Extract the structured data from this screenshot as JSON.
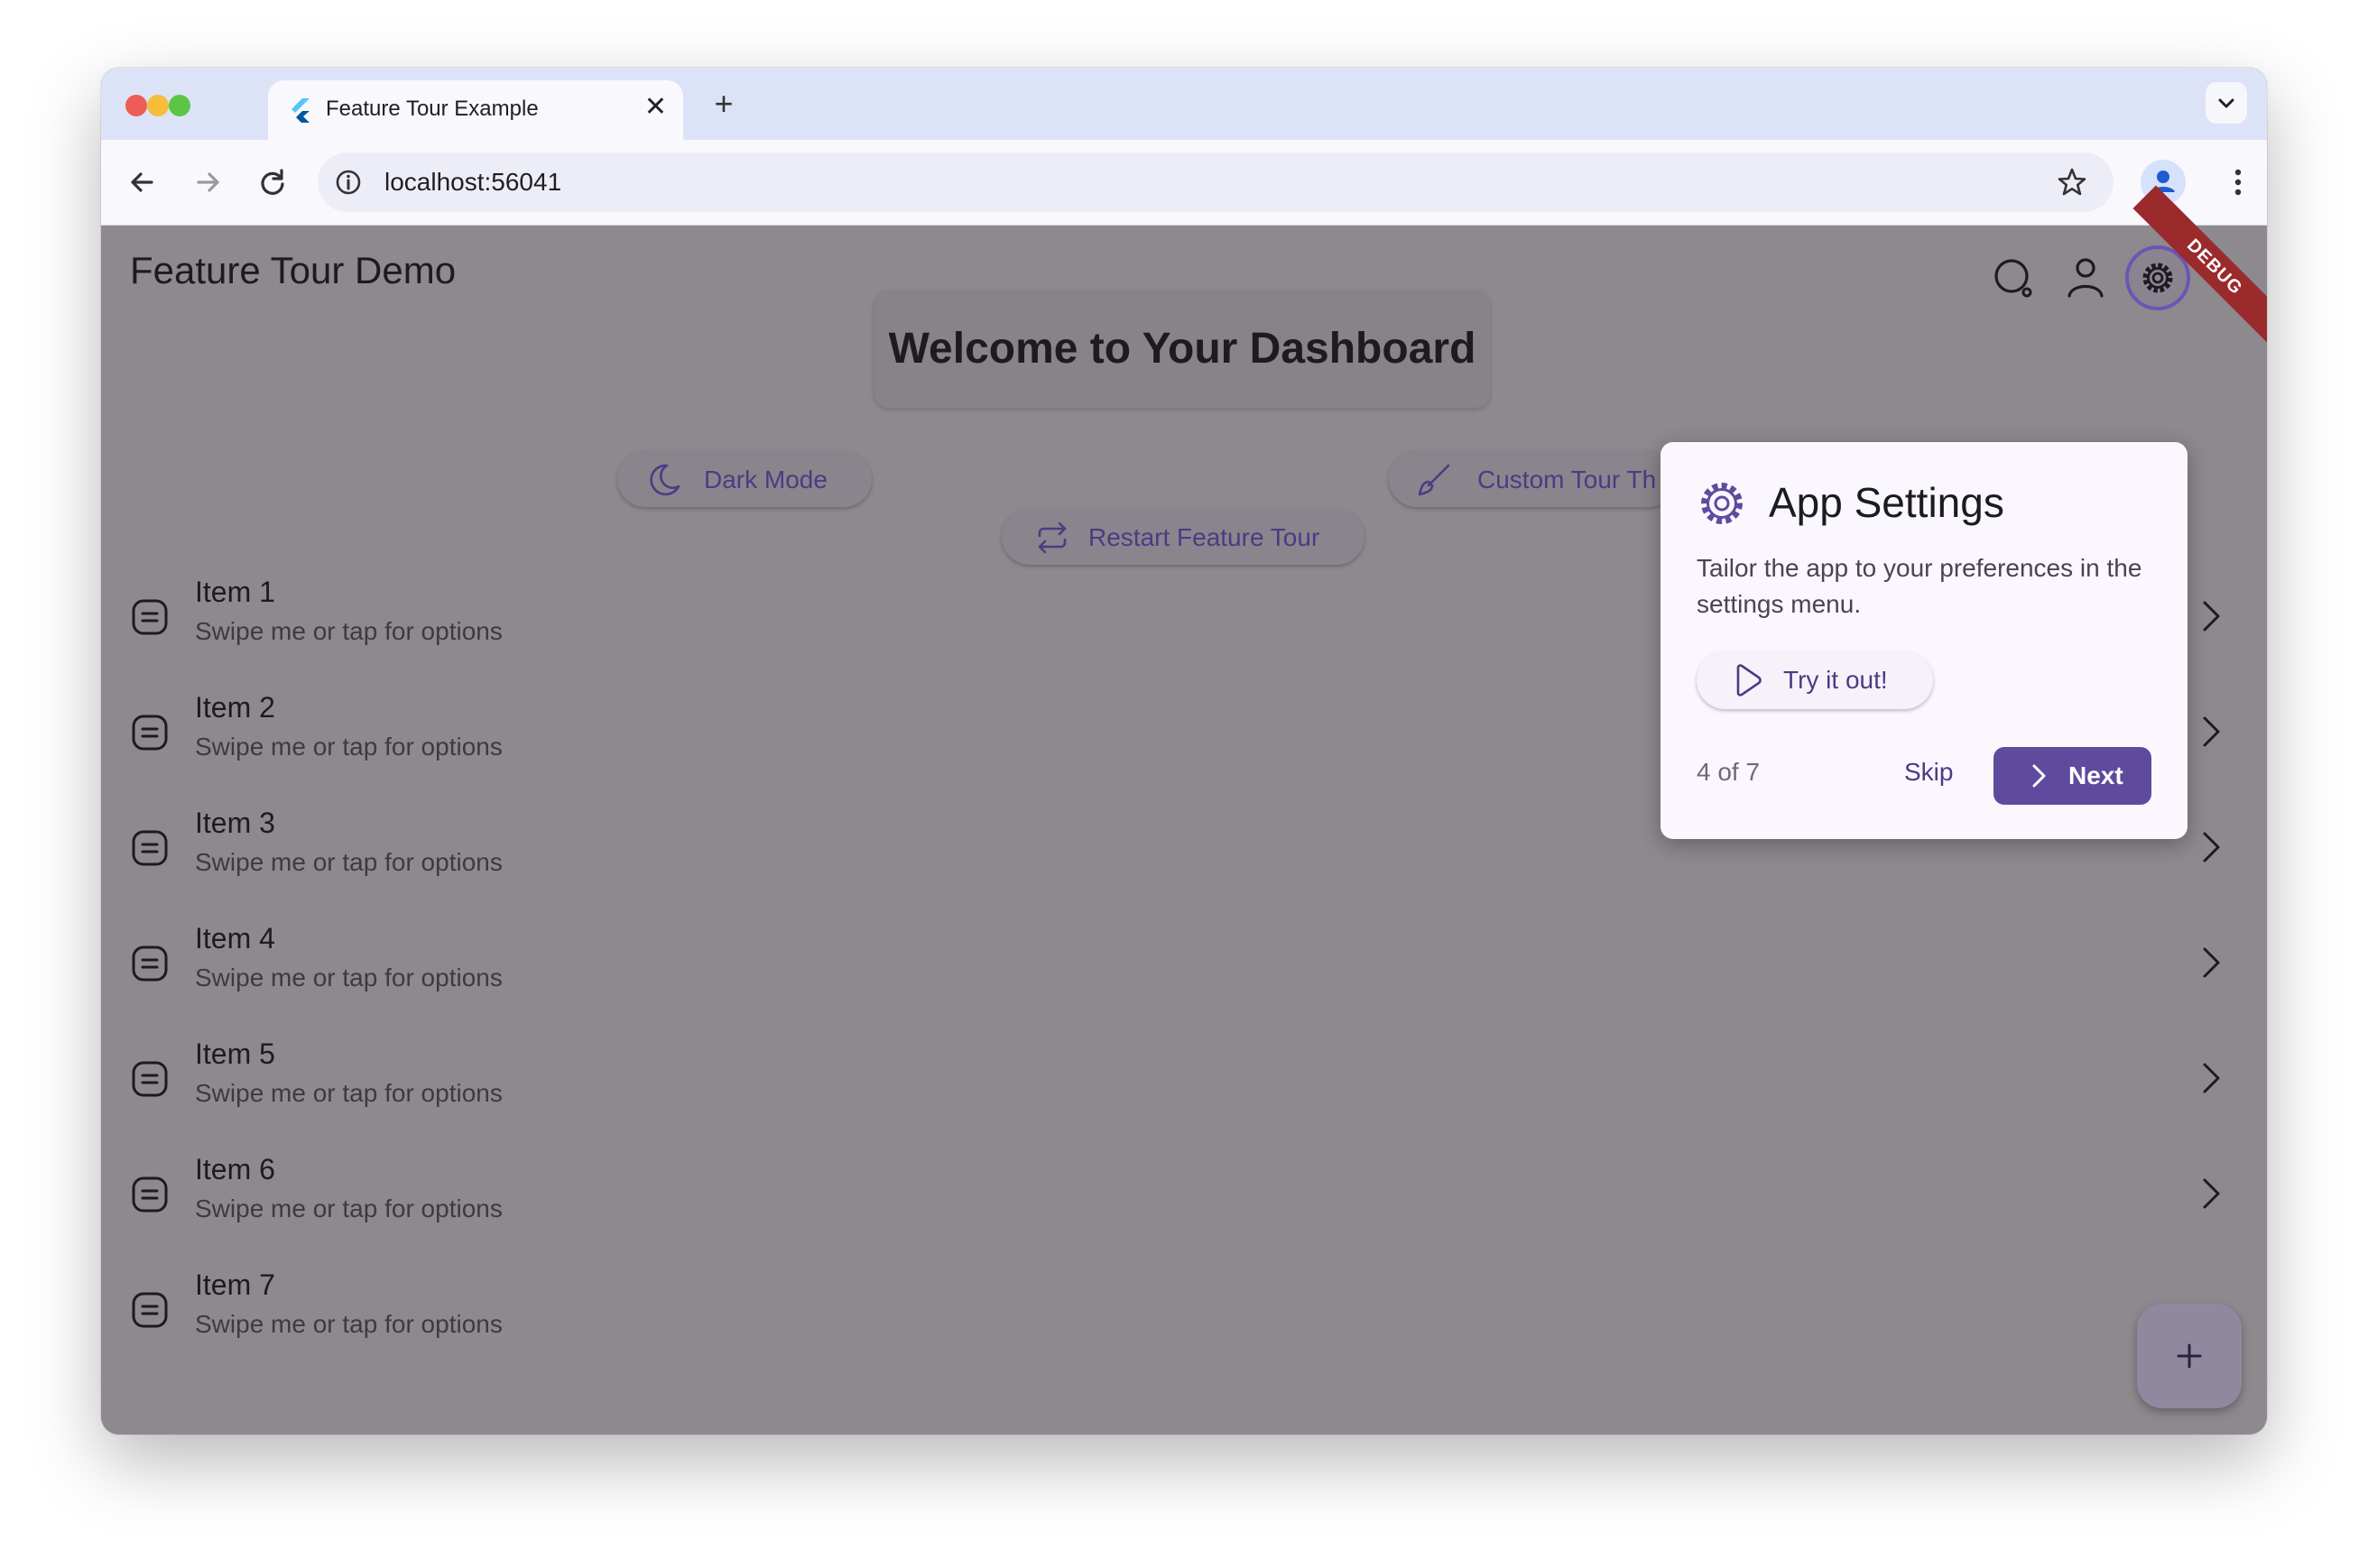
{
  "browser": {
    "tab_title": "Feature Tour Example",
    "tab_close": "✕",
    "new_tab": "+",
    "url": "localhost:56041"
  },
  "app": {
    "title": "Feature Tour Demo",
    "debug_banner": "DEBUG",
    "welcome": "Welcome to Your Dashboard",
    "buttons": {
      "dark_mode": "Dark Mode",
      "custom_theme": "Custom Tour Th",
      "restart_tour": "Restart Feature Tour"
    },
    "items": [
      {
        "title": "Item 1",
        "subtitle": "Swipe me or tap for options"
      },
      {
        "title": "Item 2",
        "subtitle": "Swipe me or tap for options"
      },
      {
        "title": "Item 3",
        "subtitle": "Swipe me or tap for options"
      },
      {
        "title": "Item 4",
        "subtitle": "Swipe me or tap for options"
      },
      {
        "title": "Item 5",
        "subtitle": "Swipe me or tap for options"
      },
      {
        "title": "Item 6",
        "subtitle": "Swipe me or tap for options"
      },
      {
        "title": "Item 7",
        "subtitle": "Swipe me or tap for options"
      }
    ]
  },
  "tour": {
    "title": "App Settings",
    "description": "Tailor the app to your preferences in the settings menu.",
    "try_label": "Try it out!",
    "step": "4 of 7",
    "skip": "Skip",
    "next": "Next"
  },
  "icons": {
    "app_bar": [
      "search-icon",
      "person-icon",
      "settings-icon"
    ],
    "list_item": "note-icon",
    "fab": "add-icon"
  },
  "colors": {
    "accent": "#5f4b9e",
    "scrim_background": "#8e898e",
    "tab_strip": "#dde3f7",
    "debug_banner": "#9a2a2c"
  }
}
